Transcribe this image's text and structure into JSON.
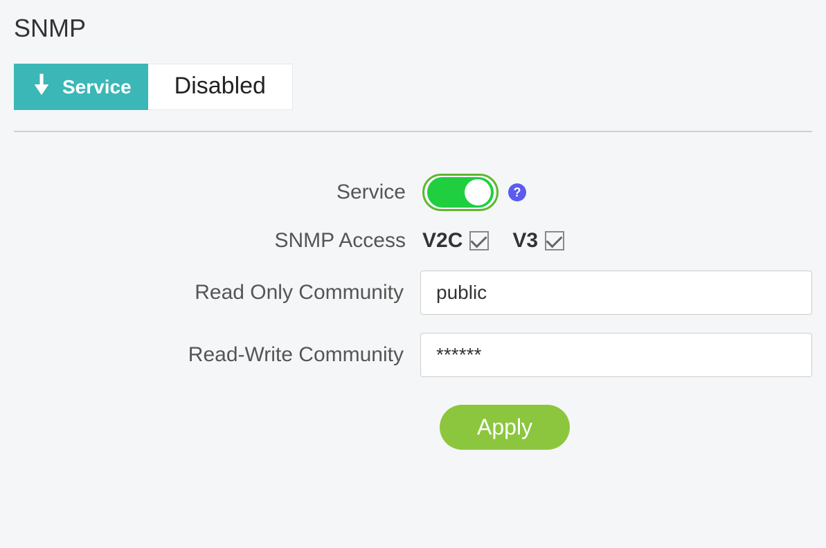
{
  "page": {
    "title": "SNMP"
  },
  "serviceBar": {
    "tabLabel": "Service",
    "status": "Disabled"
  },
  "form": {
    "serviceLabel": "Service",
    "serviceToggle": true,
    "accessLabel": "SNMP Access",
    "accessOptions": {
      "v2c": {
        "label": "V2C",
        "checked": true
      },
      "v3": {
        "label": "V3",
        "checked": true
      }
    },
    "readOnlyLabel": "Read Only Community",
    "readOnlyValue": "public",
    "readWriteLabel": "Read-Write Community",
    "readWriteValue": "******",
    "applyLabel": "Apply"
  }
}
